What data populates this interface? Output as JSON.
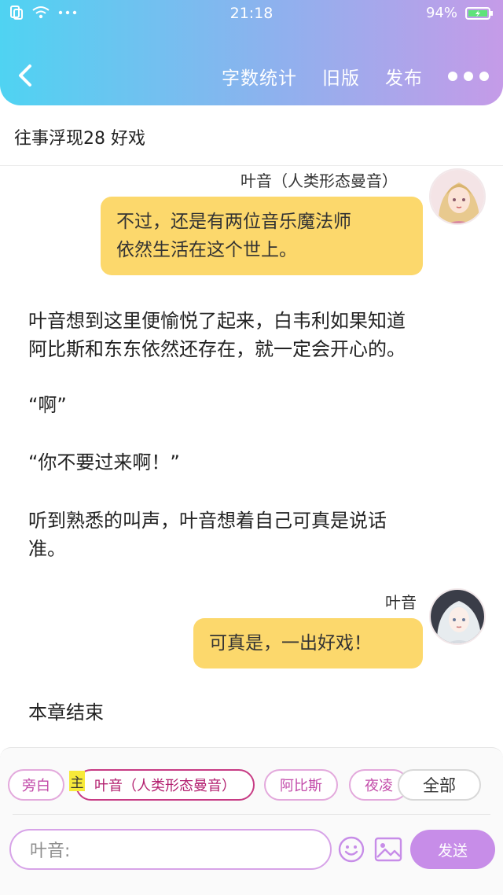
{
  "status_bar": {
    "time": "21:18",
    "battery": "94%",
    "icons": [
      "sim-icon",
      "wifi-icon",
      "more-notifications-icon",
      "battery-icon"
    ]
  },
  "nav": {
    "back_icon": "chevron-left-icon",
    "actions": [
      "字数统计",
      "旧版",
      "发布"
    ],
    "more_icon": "more-dots-icon"
  },
  "chapter": {
    "title": "往事浮现28 好戏"
  },
  "messages": [
    {
      "speaker": "叶音（人类形态曼音）",
      "text_lines": [
        "不过，还是有两位音乐魔法师",
        "依然生活在这个世上。"
      ]
    },
    {
      "narration": [
        "叶音想到这里便愉悦了起来，白韦利如果知道",
        "阿比斯和东东依然还存在，就一定会开心的。"
      ]
    },
    {
      "narration": [
        "“啊”"
      ]
    },
    {
      "narration": [
        "“你不要过来啊！”"
      ]
    },
    {
      "narration": [
        "听到熟悉的叫声，叶音想着自己可真是说话",
        "准。"
      ]
    },
    {
      "speaker": "叶音",
      "text_lines": [
        "可真是，一出好戏！"
      ]
    },
    {
      "narration": [
        "本章结束"
      ]
    }
  ],
  "role_bar": {
    "chips": [
      "旁白",
      "叶音（人类形态曼音）",
      "阿比斯",
      "夜凌"
    ],
    "main_tag": "主",
    "all_button": "全部"
  },
  "composer": {
    "placeholder": "叶音:",
    "send_label": "发送",
    "emoji_icon": "emoji-icon",
    "image_icon": "image-icon"
  },
  "colors": {
    "header_gradient_start": "#4fd3f2",
    "header_gradient_end": "#c59be8",
    "bubble": "#fcd86c",
    "send_button": "#c78de8",
    "chip_border": "#e3a9dc",
    "chip_active": "#c73b84"
  }
}
